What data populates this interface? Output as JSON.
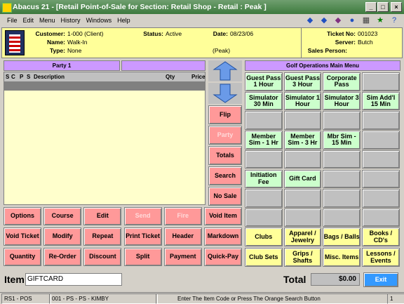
{
  "window": {
    "title": "Abacus 21 - [Retail Point-of-Sale for Section: Retail Shop - Retail : Peak ]"
  },
  "menu": [
    "File",
    "Edit",
    "Menu",
    "History",
    "Windows",
    "Help"
  ],
  "header": {
    "customer_label": "Customer:",
    "customer": "1-000 (Client)",
    "name_label": "Name:",
    "name": "Walk-In",
    "type_label": "Type:",
    "type": "None",
    "status_label": "Status:",
    "status": "Active",
    "date_label": "Date:",
    "date": "08/23/06",
    "period": "(Peak)",
    "ticket_label": "Ticket No:",
    "ticket": "001023",
    "server_label": "Server:",
    "server": "Butch",
    "salesperson_label": "Sales Person:",
    "salesperson": ""
  },
  "party": {
    "title": "Party 1"
  },
  "columns": {
    "s": "S",
    "c": "C",
    "p": "P",
    "s2": "S",
    "description": "Description",
    "qty": "Qty",
    "price": "Price"
  },
  "side_buttons": {
    "flip": "Flip",
    "party": "Party",
    "totals": "Totals",
    "search": "Search",
    "no_sale": "No Sale"
  },
  "main_menu": {
    "title": "Golf Operations Main Menu",
    "buttons": [
      "Guest Pass 1 Hour",
      "Guest Pass 3 Hour",
      "Corporate Pass",
      "",
      "Simulator 30 Min",
      "Simulator 1 Hour",
      "Simulator 3 Hour",
      "Sim Add'l 15 Min",
      "",
      "",
      "",
      "",
      "Member Sim - 1 Hr",
      "Member Sim - 3 Hr",
      "Mbr Sim - 15 Min",
      "",
      "",
      "",
      "",
      "",
      "Initiation Fee",
      "Gift Card",
      "",
      "",
      "",
      "",
      "",
      "",
      "",
      "",
      "",
      ""
    ],
    "categories": [
      "Clubs",
      "Apparel / Jewelry",
      "Bags / Balls",
      "Books / CD's",
      "Club Sets",
      "Grips / Shafts",
      "Misc. Items",
      "Lessons / Events"
    ]
  },
  "functions": [
    "Options",
    "Course",
    "Edit",
    "Send",
    "Fire",
    "Void Item",
    "Void Ticket",
    "Modify",
    "Repeat",
    "Print Ticket",
    "Header",
    "Markdown",
    "Quantity",
    "Re-Order",
    "Discount",
    "Split",
    "Payment",
    "Quick-Pay"
  ],
  "bottom": {
    "item_label": "Item",
    "item_value": "GIFTCARD",
    "total_label": "Total",
    "total_value": "$0.00",
    "exit": "Exit"
  },
  "status": {
    "station": "RS1 - POS",
    "user": "001 - PS - PS - KIMBY",
    "message": "Enter The Item Code or Press The Orange Search Button",
    "page": "1"
  }
}
